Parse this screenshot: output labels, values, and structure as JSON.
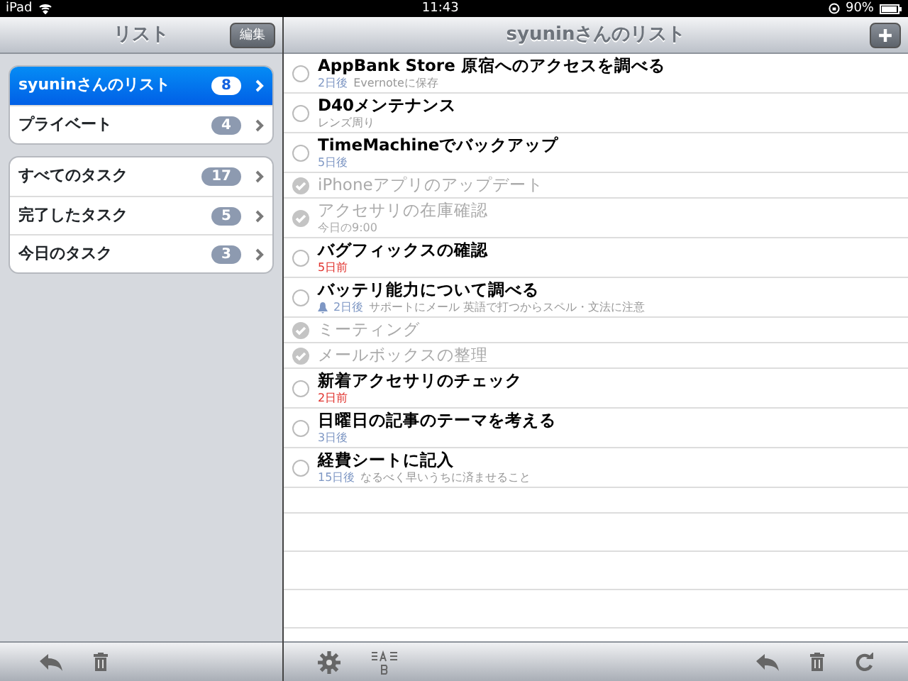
{
  "status_bar": {
    "device": "iPad",
    "time": "11:43",
    "battery": "90%"
  },
  "sidebar": {
    "title": "リスト",
    "edit_button": "編集",
    "groups": [
      [
        {
          "label": "syuninさんのリスト",
          "count": "8",
          "selected": true
        },
        {
          "label": "プライベート",
          "count": "4",
          "selected": false
        }
      ],
      [
        {
          "label": "すべてのタスク",
          "count": "17",
          "selected": false
        },
        {
          "label": "完了したタスク",
          "count": "5",
          "selected": false
        },
        {
          "label": "今日のタスク",
          "count": "3",
          "selected": false
        }
      ]
    ]
  },
  "main": {
    "title": "syuninさんのリスト",
    "tasks": [
      {
        "title": "AppBank Store 原宿へのアクセスを調べる",
        "checked": false,
        "due": {
          "text": "2日後",
          "color": "#7e97c4"
        },
        "note": "Evernoteに保存",
        "alarm": false
      },
      {
        "title": "D40メンテナンス",
        "checked": false,
        "note": "レンズ周り",
        "alarm": false
      },
      {
        "title": "TimeMachineでバックアップ",
        "checked": false,
        "due": {
          "text": "5日後",
          "color": "#7e97c4"
        },
        "alarm": false
      },
      {
        "title": "iPhoneアプリのアップデート",
        "checked": true,
        "alarm": false
      },
      {
        "title": "アクセサリの在庫確認",
        "checked": true,
        "due": {
          "text": "今日の9:00",
          "color": "#aaaaaa"
        },
        "alarm": false
      },
      {
        "title": "バグフィックスの確認",
        "checked": false,
        "due": {
          "text": "5日前",
          "color": "#e0302b"
        },
        "alarm": false
      },
      {
        "title": "バッテリ能力について調べる",
        "checked": false,
        "due": {
          "text": "2日後",
          "color": "#7e97c4"
        },
        "note": "サポートにメール 英語で打つからスペル・文法に注意",
        "alarm": true
      },
      {
        "title": "ミーティング",
        "checked": true,
        "alarm": false
      },
      {
        "title": "メールボックスの整理",
        "checked": true,
        "alarm": false
      },
      {
        "title": "新着アクセサリのチェック",
        "checked": false,
        "due": {
          "text": "2日前",
          "color": "#e0302b"
        },
        "alarm": false
      },
      {
        "title": "日曜日の記事のテーマを考える",
        "checked": false,
        "due": {
          "text": "3日後",
          "color": "#7e97c4"
        },
        "alarm": false
      },
      {
        "title": "経費シートに記入",
        "checked": false,
        "due": {
          "text": "15日後",
          "color": "#7e97c4"
        },
        "note": "なるべく早いうちに済ませること",
        "alarm": false
      }
    ]
  }
}
